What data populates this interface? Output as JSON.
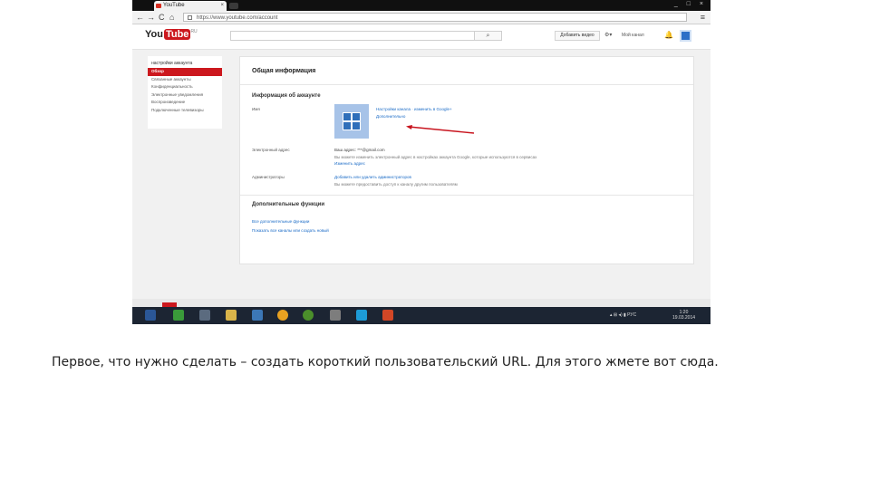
{
  "browser": {
    "tab_title": "YouTube",
    "tab_close": "×",
    "url": "https://www.youtube.com/account",
    "window_controls": "_ □ ×",
    "nav": {
      "back": "←",
      "forward": "→",
      "reload": "C",
      "home": "⌂"
    },
    "menu_icon": "≡"
  },
  "youtube": {
    "logo_you": "You",
    "logo_tube": "Tube",
    "logo_region": "RU",
    "search_icon": "⌕",
    "add_video_label": "Добавить видео",
    "gear": "⚙",
    "caret": "▾",
    "my_channel": "Мой канал",
    "bell": "🔔",
    "sidebar": {
      "header": "настройки аккаунта",
      "items": [
        {
          "label": "Обзор",
          "active": true
        },
        {
          "label": "Связанные аккаунты",
          "active": false
        },
        {
          "label": "Конфиденциальность",
          "active": false
        },
        {
          "label": "Электронные уведомления",
          "active": false
        },
        {
          "label": "Воспроизведение",
          "active": false
        },
        {
          "label": "Подключенные телевизоры",
          "active": false
        }
      ]
    },
    "main": {
      "title": "Общая информация",
      "account_section": "Информация об аккаунте",
      "name_label": "Имя",
      "name_link": "Настройки канала · изменить в Google+",
      "advanced_link": "Дополнительно",
      "email_label": "Электронный адрес",
      "email_value": "Ваш адрес: ***@gmail.com",
      "email_note": "Вы можете изменить электронный адрес в настройках аккаунта Google, которые используются в сервисах",
      "email_change": "Изменить адрес",
      "admins_label": "Администраторы",
      "admins_link": "Добавить или удалить администраторов",
      "admins_note": "Вы можете предоставить доступ к каналу другим пользователям",
      "extra_section": "Дополнительные функции",
      "extra_link1": "Все дополнительные функции",
      "extra_link2": "Показать все каналы или создать новый"
    }
  },
  "taskbar": {
    "tray_text": "▴ ⊞ ◂) ▮ РУС",
    "time": "1:20",
    "date": "19.03.2014"
  },
  "caption": "Первое, что нужно сделать – создать короткий пользовательский URL. Для этого жмете вот сюда.",
  "colors": {
    "youtube_red": "#cc181e",
    "link_blue": "#1a6bc6",
    "arrow_red": "#c8141e",
    "taskbar": "#1c2533"
  }
}
